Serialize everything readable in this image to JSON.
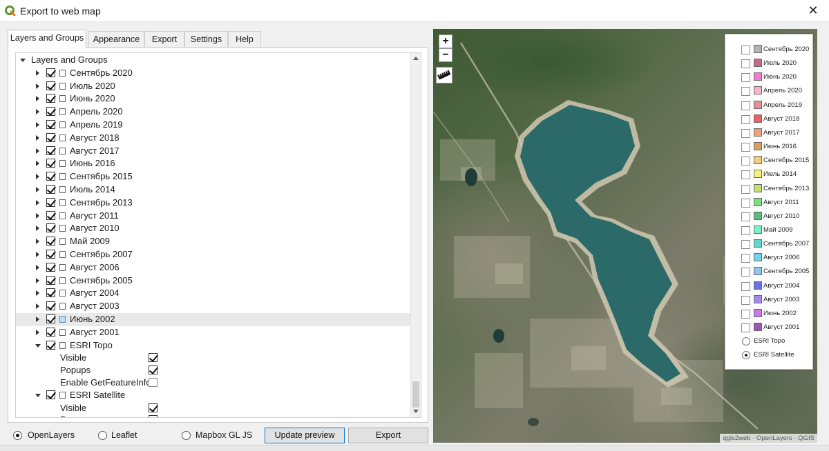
{
  "window": {
    "title": "Export to web map",
    "app_icon": "qgis-icon",
    "close_glyph": "✕"
  },
  "tabs": [
    "Layers and Groups",
    "Appearance",
    "Export",
    "Settings",
    "Help"
  ],
  "tree": {
    "root_label": "Layers and Groups",
    "layers": [
      {
        "label": "Сентябрь 2020",
        "checked": true
      },
      {
        "label": "Июль 2020",
        "checked": true
      },
      {
        "label": "Июнь 2020",
        "checked": true
      },
      {
        "label": "Апрель 2020",
        "checked": true
      },
      {
        "label": "Апрель 2019",
        "checked": true
      },
      {
        "label": "Август 2018",
        "checked": true
      },
      {
        "label": "Август 2017",
        "checked": true
      },
      {
        "label": "Июнь 2016",
        "checked": true
      },
      {
        "label": "Сентябрь 2015",
        "checked": true
      },
      {
        "label": "Июль 2014",
        "checked": true
      },
      {
        "label": "Сентябрь 2013",
        "checked": true
      },
      {
        "label": "Август 2011",
        "checked": true
      },
      {
        "label": "Август 2010",
        "checked": true
      },
      {
        "label": "Май 2009",
        "checked": true
      },
      {
        "label": "Сентябрь 2007",
        "checked": true
      },
      {
        "label": "Август 2006",
        "checked": true
      },
      {
        "label": "Сентябрь 2005",
        "checked": true
      },
      {
        "label": "Август 2004",
        "checked": true
      },
      {
        "label": "Август 2003",
        "checked": true
      },
      {
        "label": "Июнь 2002",
        "checked": true,
        "selected": true
      },
      {
        "label": "Август 2001",
        "checked": true
      }
    ],
    "esri_topo": {
      "label": "ESRI Topo",
      "options": [
        {
          "label": "Visible",
          "checked": true
        },
        {
          "label": "Popups",
          "checked": true
        },
        {
          "label": "Enable GetFeatureInfo?",
          "checked": false
        }
      ]
    },
    "esri_satellite": {
      "label": "ESRI Satellite",
      "options": [
        {
          "label": "Visible",
          "checked": true
        },
        {
          "label": "Popups",
          "checked": true
        }
      ]
    }
  },
  "bottom_bar": {
    "formats": [
      {
        "label": "OpenLayers",
        "selected": true
      },
      {
        "label": "Leaflet",
        "selected": false
      },
      {
        "label": "Mapbox GL JS",
        "selected": false
      }
    ],
    "update_preview_label": "Update preview",
    "export_label": "Export"
  },
  "map": {
    "zoom_in": "+",
    "zoom_out": "−",
    "attribution": "qgis2web · OpenLayers · QGIS",
    "water_color": "#2b6a68",
    "legend": [
      {
        "label": "Сентябрь 2020",
        "color": "#b4b4b4"
      },
      {
        "label": "Июль 2020",
        "color": "#c46b8e"
      },
      {
        "label": "Июнь 2020",
        "color": "#f47ad6"
      },
      {
        "label": "Апрель 2020",
        "color": "#f7b6c8"
      },
      {
        "label": "Апрель 2019",
        "color": "#e8909a"
      },
      {
        "label": "Август 2018",
        "color": "#f06060"
      },
      {
        "label": "Август 2017",
        "color": "#f4a07e"
      },
      {
        "label": "Июнь 2016",
        "color": "#d9a05e"
      },
      {
        "label": "Сентябрь 2015",
        "color": "#f2cf7e"
      },
      {
        "label": "Июль 2014",
        "color": "#f7f07a"
      },
      {
        "label": "Сентябрь 2013",
        "color": "#c6df72"
      },
      {
        "label": "Август 2011",
        "color": "#7ee07a"
      },
      {
        "label": "Август 2010",
        "color": "#5dba7e"
      },
      {
        "label": "Май 2009",
        "color": "#7af2c6"
      },
      {
        "label": "Сентябрь 2007",
        "color": "#62d6cc"
      },
      {
        "label": "Август 2006",
        "color": "#74d4f0"
      },
      {
        "label": "Сентябрь 2005",
        "color": "#8ec8ea"
      },
      {
        "label": "Август 2004",
        "color": "#6a72e8"
      },
      {
        "label": "Август 2003",
        "color": "#a48aea"
      },
      {
        "label": "Июнь 2002",
        "color": "#c77ae4"
      },
      {
        "label": "Август 2001",
        "color": "#9a56b8"
      }
    ],
    "basemaps": [
      {
        "label": "ESRI Topo",
        "selected": false
      },
      {
        "label": "ESRI Satellite",
        "selected": true
      }
    ]
  }
}
